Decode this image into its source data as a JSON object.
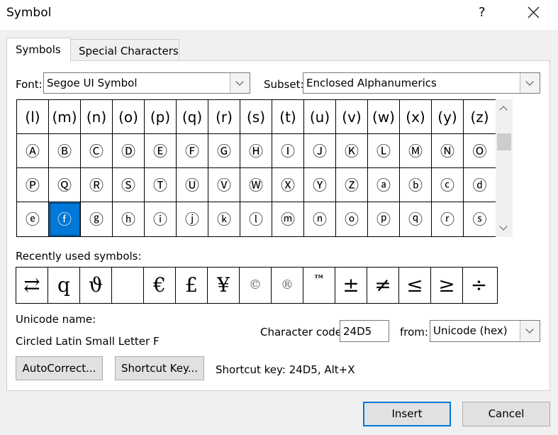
{
  "window": {
    "title": "Symbol",
    "help_glyph": "?"
  },
  "tabs": [
    {
      "label": "Symbols",
      "active": true
    },
    {
      "label": "Special Characters",
      "active": false
    }
  ],
  "font": {
    "label": "Font:",
    "value": "Segoe UI Symbol"
  },
  "subset": {
    "label": "Subset:",
    "value": "Enclosed Alphanumerics"
  },
  "symbol_grid": {
    "rows": [
      [
        "(l)",
        "(m)",
        "(n)",
        "(o)",
        "(p)",
        "(q)",
        "(r)",
        "(s)",
        "(t)",
        "(u)",
        "(v)",
        "(w)",
        "(x)",
        "(y)",
        "(z)"
      ],
      [
        "Ⓐ",
        "Ⓑ",
        "Ⓒ",
        "Ⓓ",
        "Ⓔ",
        "Ⓕ",
        "Ⓖ",
        "Ⓗ",
        "Ⓘ",
        "Ⓙ",
        "Ⓚ",
        "Ⓛ",
        "Ⓜ",
        "Ⓝ",
        "Ⓞ"
      ],
      [
        "Ⓟ",
        "Ⓠ",
        "Ⓡ",
        "Ⓢ",
        "Ⓣ",
        "Ⓤ",
        "Ⓥ",
        "Ⓦ",
        "Ⓧ",
        "Ⓨ",
        "Ⓩ",
        "ⓐ",
        "ⓑ",
        "ⓒ",
        "ⓓ"
      ],
      [
        "ⓔ",
        "ⓕ",
        "ⓖ",
        "ⓗ",
        "ⓘ",
        "ⓙ",
        "ⓚ",
        "ⓛ",
        "ⓜ",
        "ⓝ",
        "ⓞ",
        "ⓟ",
        "ⓠ",
        "ⓡ",
        "ⓢ"
      ]
    ],
    "selected": {
      "row": 3,
      "col": 1
    },
    "selected_color": "#0078d7"
  },
  "recent": {
    "label": "Recently used symbols:",
    "symbols": [
      "⇄",
      "q",
      "ϑ",
      " ",
      "€",
      "£",
      "¥",
      "©",
      "®",
      "™",
      "±",
      "≠",
      "≤",
      "≥",
      "÷"
    ]
  },
  "unicode_name": {
    "label": "Unicode name:",
    "value": "Circled Latin Small Letter F"
  },
  "char_code": {
    "label": "Character code:",
    "value": "24D5"
  },
  "from": {
    "label": "from:",
    "value": "Unicode (hex)"
  },
  "buttons": {
    "autocorrect": "AutoCorrect...",
    "shortcut_key": "Shortcut Key...",
    "insert": "Insert",
    "cancel": "Cancel"
  },
  "shortcut_text": "Shortcut key: 24D5, Alt+X",
  "icons": {
    "close": "close-icon",
    "dropdown": "chevron-down-icon",
    "scroll_up": "chevron-up-icon",
    "scroll_down": "chevron-down-icon"
  }
}
